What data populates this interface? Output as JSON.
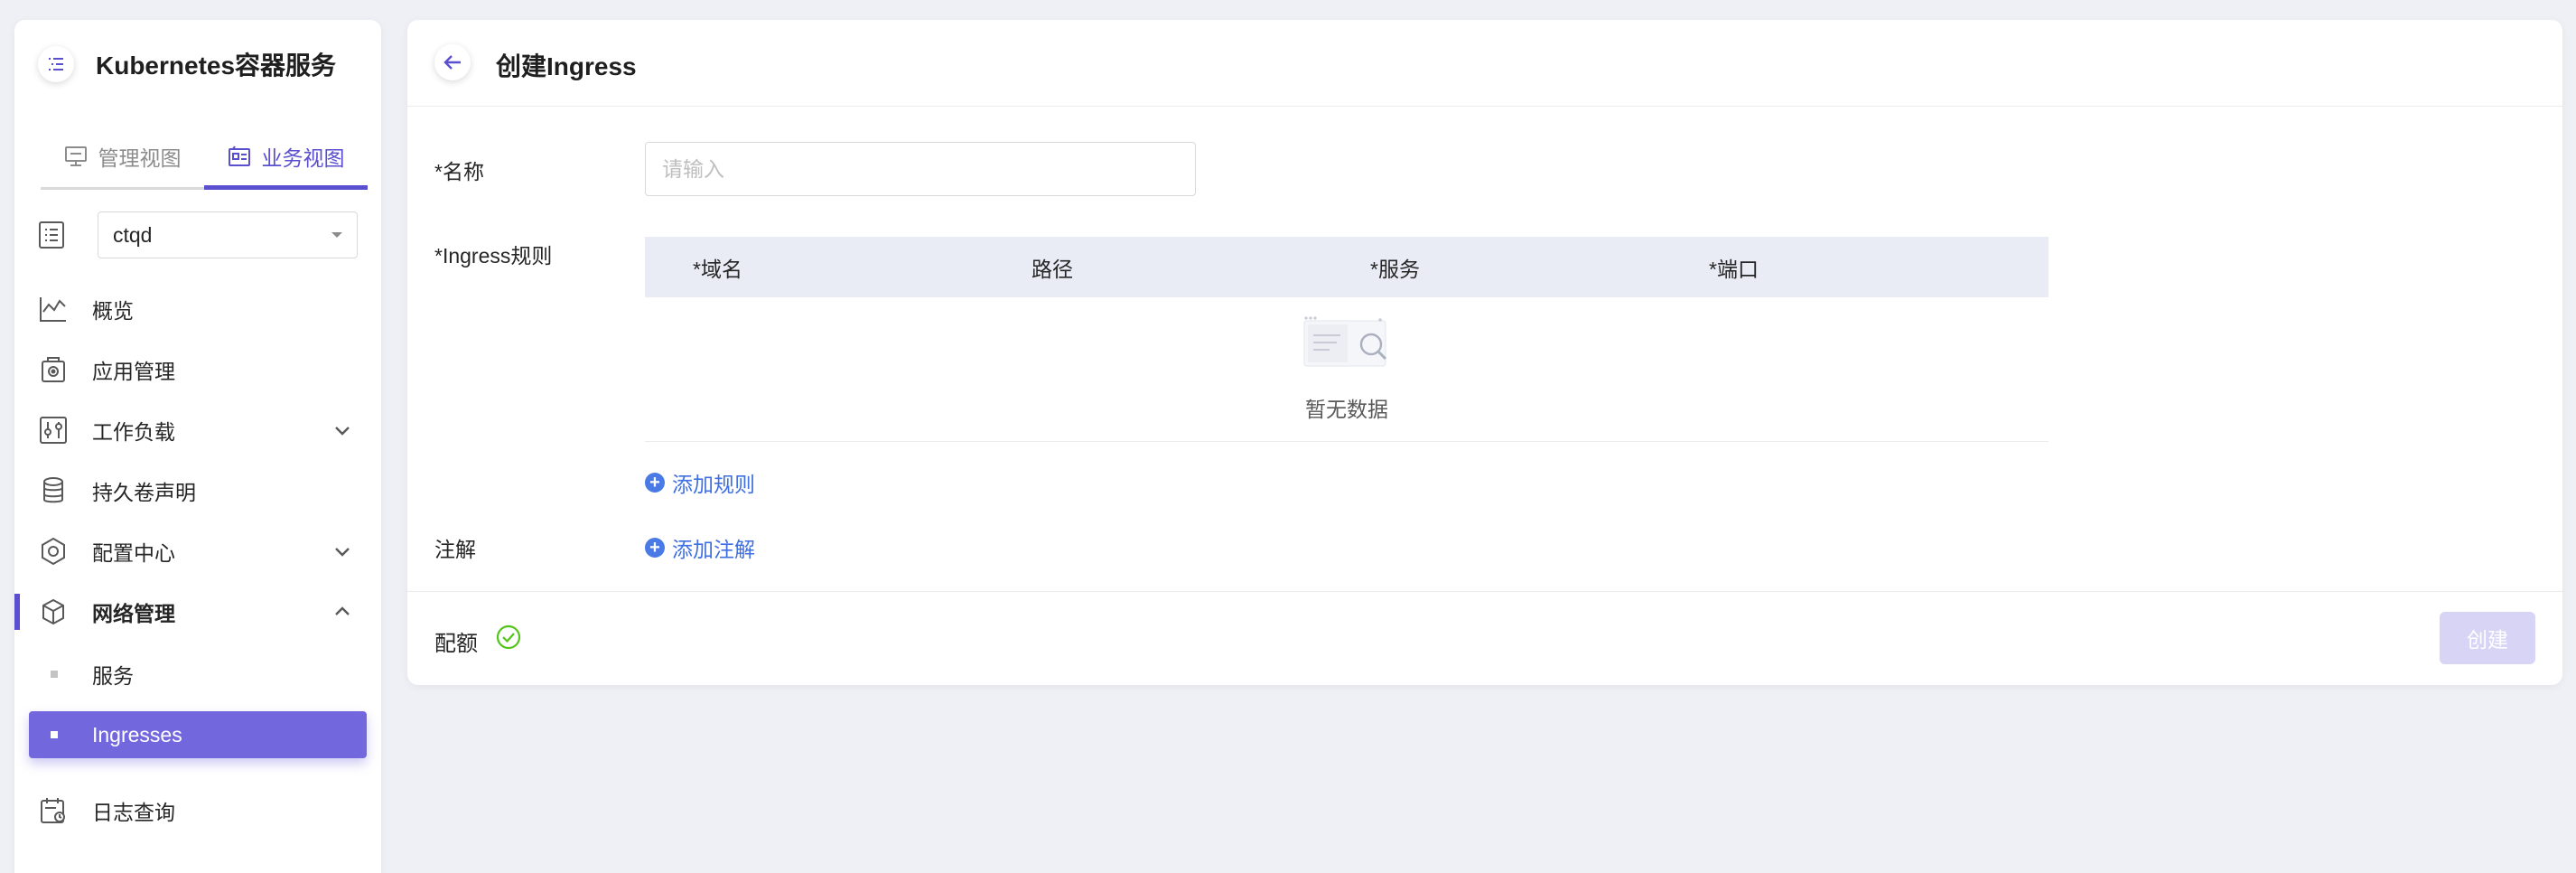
{
  "app": {
    "title": "Kubernetes容器服务"
  },
  "view_tabs": [
    {
      "label": "管理视图",
      "active": false,
      "icon": "monitor-icon"
    },
    {
      "label": "业务视图",
      "active": true,
      "icon": "business-view-icon"
    }
  ],
  "namespace": {
    "value": "ctqd"
  },
  "menu": {
    "overview": "概览",
    "app_mgmt": "应用管理",
    "workload": "工作负载",
    "pvc": "持久卷声明",
    "config": "配置中心",
    "network": "网络管理",
    "services": "服务",
    "ingresses": "Ingresses",
    "logs": "日志查询"
  },
  "page": {
    "title": "创建Ingress"
  },
  "form": {
    "name_label": "*名称",
    "name_placeholder": "请输入",
    "name_value": "",
    "rules_label": "*Ingress规则",
    "rules_columns": [
      "*域名",
      "路径",
      "*服务",
      "*端口"
    ],
    "empty_text": "暂无数据",
    "add_rule": "添加规则",
    "annotations_label": "注解",
    "add_annotation": "添加注解"
  },
  "footer": {
    "quota_label": "配额",
    "create_button": "创建"
  },
  "colors": {
    "accent": "#5a4fcf",
    "active_item_bg": "#7367de",
    "link": "#3f6fe0",
    "success": "#52c41a",
    "disabled_button": "#d7d4f6"
  }
}
